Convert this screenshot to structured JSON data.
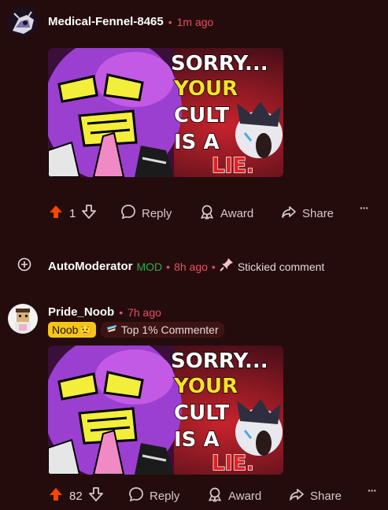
{
  "comments": [
    {
      "username": "Medical-Fennel-8465",
      "separator": "•",
      "time": "1m ago",
      "image": {
        "lines": [
          "SORRY...",
          "YOUR",
          "CULT",
          "IS A",
          "LIE."
        ]
      },
      "actions": {
        "votes": "1",
        "reply": "Reply",
        "award": "Award",
        "share": "Share",
        "more": "···"
      }
    },
    {
      "username": "Pride_Noob",
      "separator": "•",
      "time": "7h ago",
      "flairs": {
        "noob": "Noob😟",
        "top": "Top 1% Commenter"
      },
      "image": {
        "lines": [
          "SORRY...",
          "YOUR",
          "CULT",
          "IS A",
          "LIE."
        ]
      },
      "actions": {
        "votes": "82",
        "reply": "Reply",
        "award": "Award",
        "share": "Share",
        "more": "···"
      }
    }
  ],
  "automod": {
    "username": "AutoModerator",
    "mod_badge": "MOD",
    "separator": "•",
    "time": "8h ago",
    "separator2": "•",
    "stickied": "Stickied comment"
  },
  "colors": {
    "background": "#250c0c",
    "upvote": "#ff4500",
    "time": "#e0506a",
    "mod": "#22b24c"
  },
  "icons": [
    "upvote-arrow-icon",
    "downvote-arrow-icon",
    "reply-bubble-icon",
    "award-ribbon-icon",
    "share-arrow-icon",
    "expand-plus-icon",
    "pin-icon",
    "top-commenter-icon"
  ]
}
